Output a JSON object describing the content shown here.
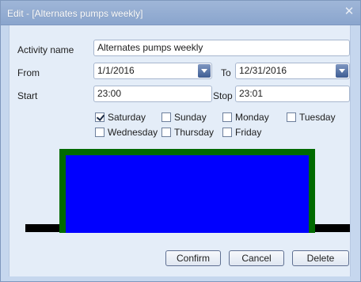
{
  "window": {
    "title": "Edit - [Alternates pumps weekly]"
  },
  "form": {
    "activity_name_label": "Activity name",
    "activity_name_value": "Alternates pumps weekly",
    "from_label": "From",
    "from_value": "1/1/2016",
    "to_label": "To",
    "to_value": "12/31/2016",
    "start_label": "Start",
    "start_value": "23:00",
    "stop_label": "Stop",
    "stop_value": "23:01"
  },
  "days": [
    {
      "label": "Saturday",
      "checked": true
    },
    {
      "label": "Sunday",
      "checked": false
    },
    {
      "label": "Monday",
      "checked": false
    },
    {
      "label": "Tuesday",
      "checked": false
    },
    {
      "label": "Wednesday",
      "checked": false
    },
    {
      "label": "Thursday",
      "checked": false
    },
    {
      "label": "Friday",
      "checked": false
    }
  ],
  "diagram": {
    "baseline_color": "#000000",
    "pulse_border_color": "#006a00",
    "pulse_fill_color": "#0000ff"
  },
  "buttons": {
    "confirm": "Confirm",
    "cancel": "Cancel",
    "delete": "Delete"
  },
  "icons": {
    "close": "close-icon",
    "dropdown": "chevron-down-icon",
    "check": "check-icon"
  }
}
